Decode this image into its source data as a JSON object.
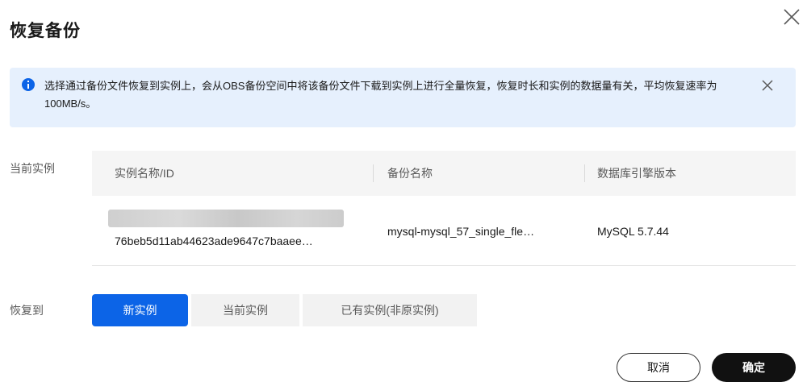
{
  "dialog": {
    "title": "恢复备份"
  },
  "notice": {
    "text": "选择通过备份文件恢复到实例上，会从OBS备份空间中将该备份文件下载到实例上进行全量恢复，恢复时长和实例的数据量有关，平均恢复速率为100MB/s。"
  },
  "current_instance": {
    "label": "当前实例",
    "columns": [
      "实例名称/ID",
      "备份名称",
      "数据库引擎版本"
    ],
    "row": {
      "instance_id": "76beb5d11ab44623ade9647c7baaee…",
      "backup_name": "mysql-mysql_57_single_fle…",
      "engine_version": "MySQL 5.7.44"
    }
  },
  "restore_to": {
    "label": "恢复到",
    "options": [
      "新实例",
      "当前实例",
      "已有实例(非原实例)"
    ],
    "selected": "新实例"
  },
  "footer": {
    "cancel_label": "取消",
    "confirm_label": "确定"
  },
  "colors": {
    "primary": "#0c64e7",
    "banner_bg": "#e6f0fd",
    "confirm_bg": "#111111"
  }
}
